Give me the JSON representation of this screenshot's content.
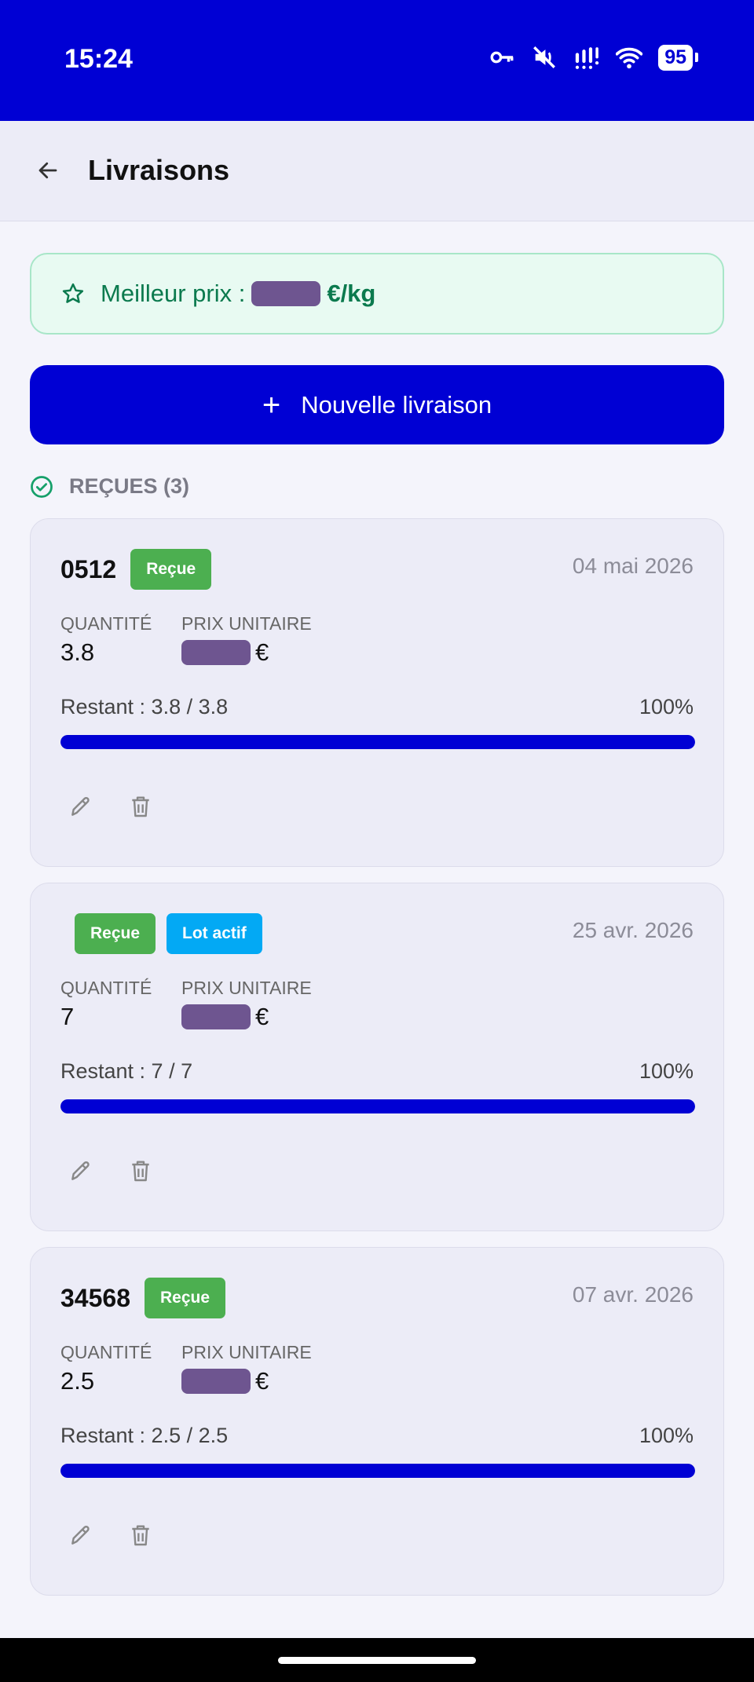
{
  "status_bar": {
    "time": "15:24",
    "battery": "95",
    "icons": [
      "key-icon",
      "mute-icon",
      "signal-icon",
      "wifi-icon",
      "battery-icon"
    ]
  },
  "app_bar": {
    "title": "Livraisons"
  },
  "best_price": {
    "label": "Meilleur prix :",
    "unit": "€/kg"
  },
  "new_delivery_label": "Nouvelle livraison",
  "section": {
    "title": "REÇUES (3)"
  },
  "colors": {
    "primary": "#0000d4",
    "green": "#4caf50",
    "blue": "#03a9f4",
    "best_price_text": "#0b7a4e"
  },
  "deliveries": [
    {
      "number": "0512",
      "badges": [
        "Reçue"
      ],
      "date": "04 mai 2026",
      "quantity_label": "QUANTITÉ",
      "unit_price_label": "PRIX UNITAIRE",
      "quantity": "3.8",
      "currency": "€",
      "remaining": "Restant : 3.8 / 3.8",
      "percent": "100%",
      "progress": 1.0
    },
    {
      "number": "",
      "badges": [
        "Reçue",
        "Lot actif"
      ],
      "date": "25 avr. 2026",
      "quantity_label": "QUANTITÉ",
      "unit_price_label": "PRIX UNITAIRE",
      "quantity": "7",
      "currency": "€",
      "remaining": "Restant : 7 / 7",
      "percent": "100%",
      "progress": 1.0
    },
    {
      "number": "34568",
      "badges": [
        "Reçue"
      ],
      "date": "07 avr. 2026",
      "quantity_label": "QUANTITÉ",
      "unit_price_label": "PRIX UNITAIRE",
      "quantity": "2.5",
      "currency": "€",
      "remaining": "Restant : 2.5 / 2.5",
      "percent": "100%",
      "progress": 1.0
    }
  ]
}
